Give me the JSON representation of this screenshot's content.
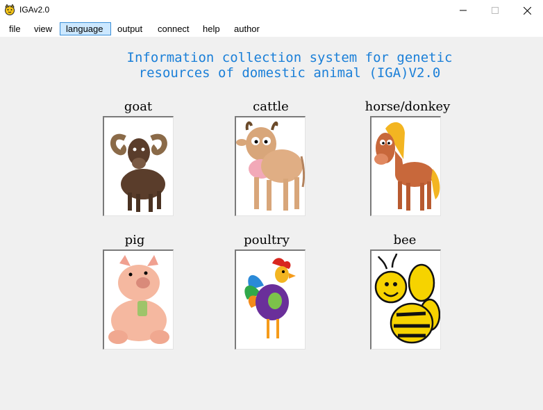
{
  "window": {
    "title": "IGAv2.0"
  },
  "menu": [
    {
      "label": "file",
      "active": false
    },
    {
      "label": "view",
      "active": false
    },
    {
      "label": "language",
      "active": true
    },
    {
      "label": "output",
      "active": false
    },
    {
      "label": "connect",
      "active": false
    },
    {
      "label": "help",
      "active": false
    },
    {
      "label": "author",
      "active": false
    }
  ],
  "heading": {
    "line1": "Information collection system for genetic",
    "line2": "resources of domestic animal (IGA)V2.0"
  },
  "animals": [
    {
      "label": "goat"
    },
    {
      "label": "cattle"
    },
    {
      "label": "horse/donkey"
    },
    {
      "label": "pig"
    },
    {
      "label": "poultry"
    },
    {
      "label": "bee"
    }
  ],
  "colors": {
    "heading": "#1a7fd8",
    "menu_active_bg": "#cce8ff",
    "menu_active_border": "#3a8fd8"
  }
}
